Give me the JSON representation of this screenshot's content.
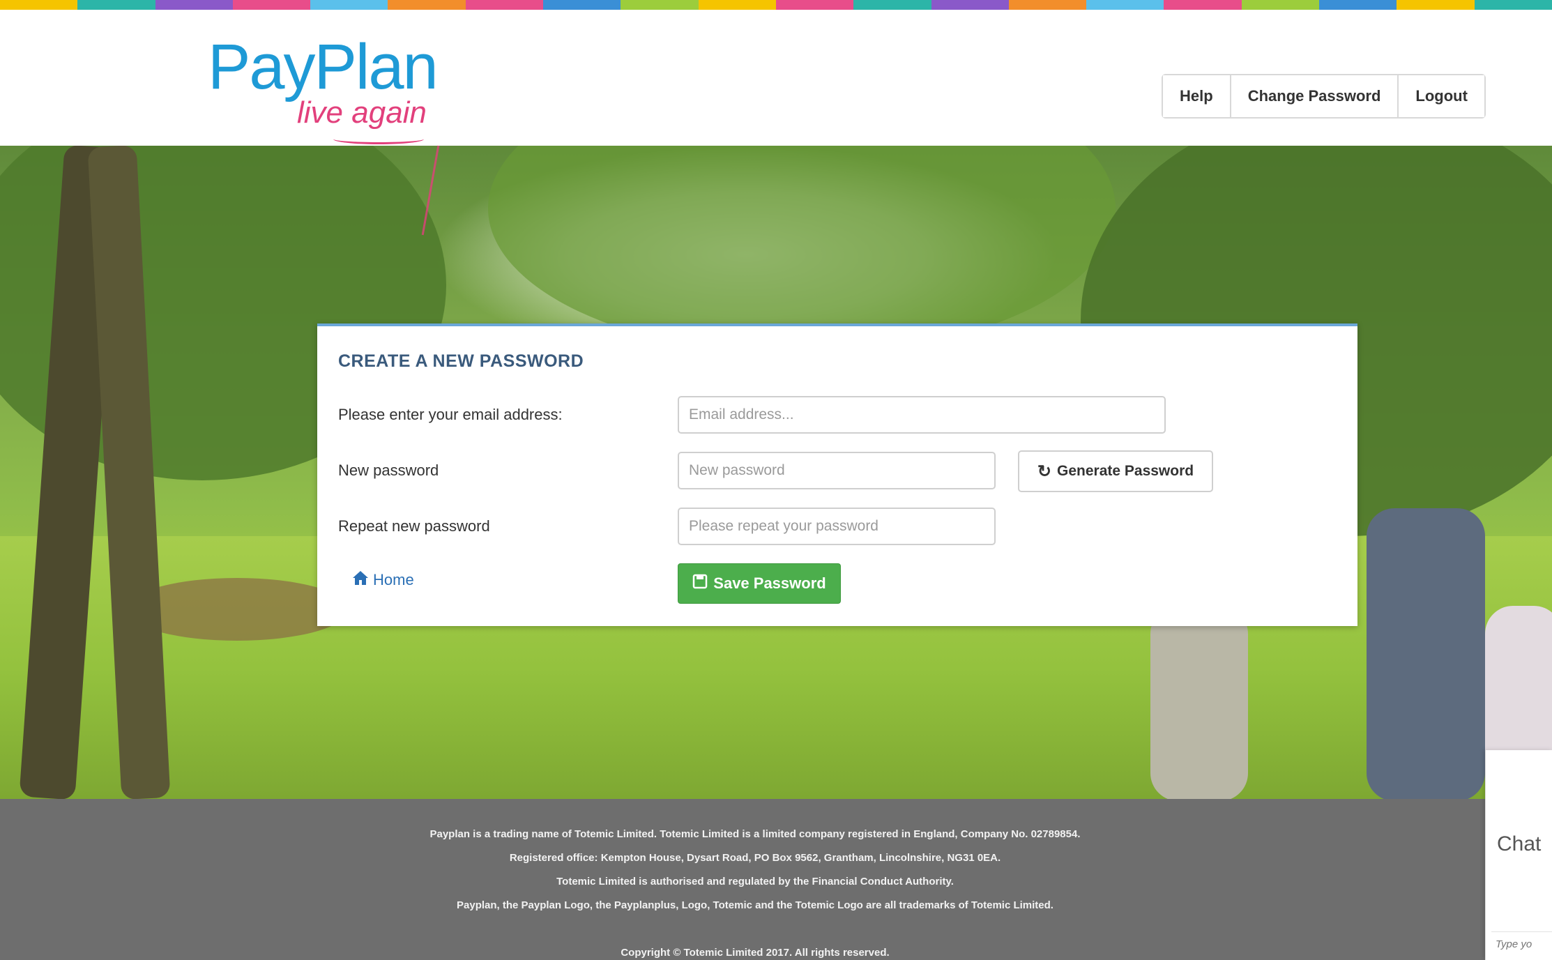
{
  "brand": {
    "name": "PayPlan",
    "tagline": "live again",
    "colors": {
      "blue": "#1e9ad6",
      "pink": "#e2407c"
    }
  },
  "stripe_colors": [
    "#f5c400",
    "#2cb5a8",
    "#8a59c9",
    "#e84d8a",
    "#5bc0eb",
    "#f28e2b",
    "#e84d8a",
    "#3a8fd6",
    "#9ccd3c",
    "#f5c400",
    "#e84d8a",
    "#2cb5a8",
    "#8a59c9",
    "#f28e2b",
    "#5bc0eb",
    "#e84d8a",
    "#9ccd3c",
    "#3a8fd6",
    "#f5c400",
    "#2cb5a8"
  ],
  "nav": {
    "help": "Help",
    "change_password": "Change Password",
    "logout": "Logout"
  },
  "form": {
    "title": "CREATE A NEW PASSWORD",
    "email_label": "Please enter your email address:",
    "email_placeholder": "Email address...",
    "new_password_label": "New password",
    "new_password_placeholder": "New password",
    "repeat_label": "Repeat new password",
    "repeat_placeholder": "Please repeat your password",
    "generate_button": "Generate Password",
    "home_link": "Home",
    "save_button": "Save Password"
  },
  "footer": {
    "line1": "Payplan is a trading name of Totemic Limited. Totemic Limited is a limited company registered in England, Company No. 02789854.",
    "line2": "Registered office: Kempton House, Dysart Road, PO Box 9562, Grantham, Lincolnshire, NG31 0EA.",
    "line3": "Totemic Limited is authorised and regulated by the Financial Conduct Authority.",
    "line4": "Payplan, the Payplan Logo, the Payplanplus, Logo, Totemic and the Totemic Logo are all trademarks of Totemic Limited.",
    "copyright": "Copyright © Totemic Limited 2017. All rights reserved."
  },
  "chat": {
    "title": "Chat",
    "input_placeholder": "Type yo"
  }
}
